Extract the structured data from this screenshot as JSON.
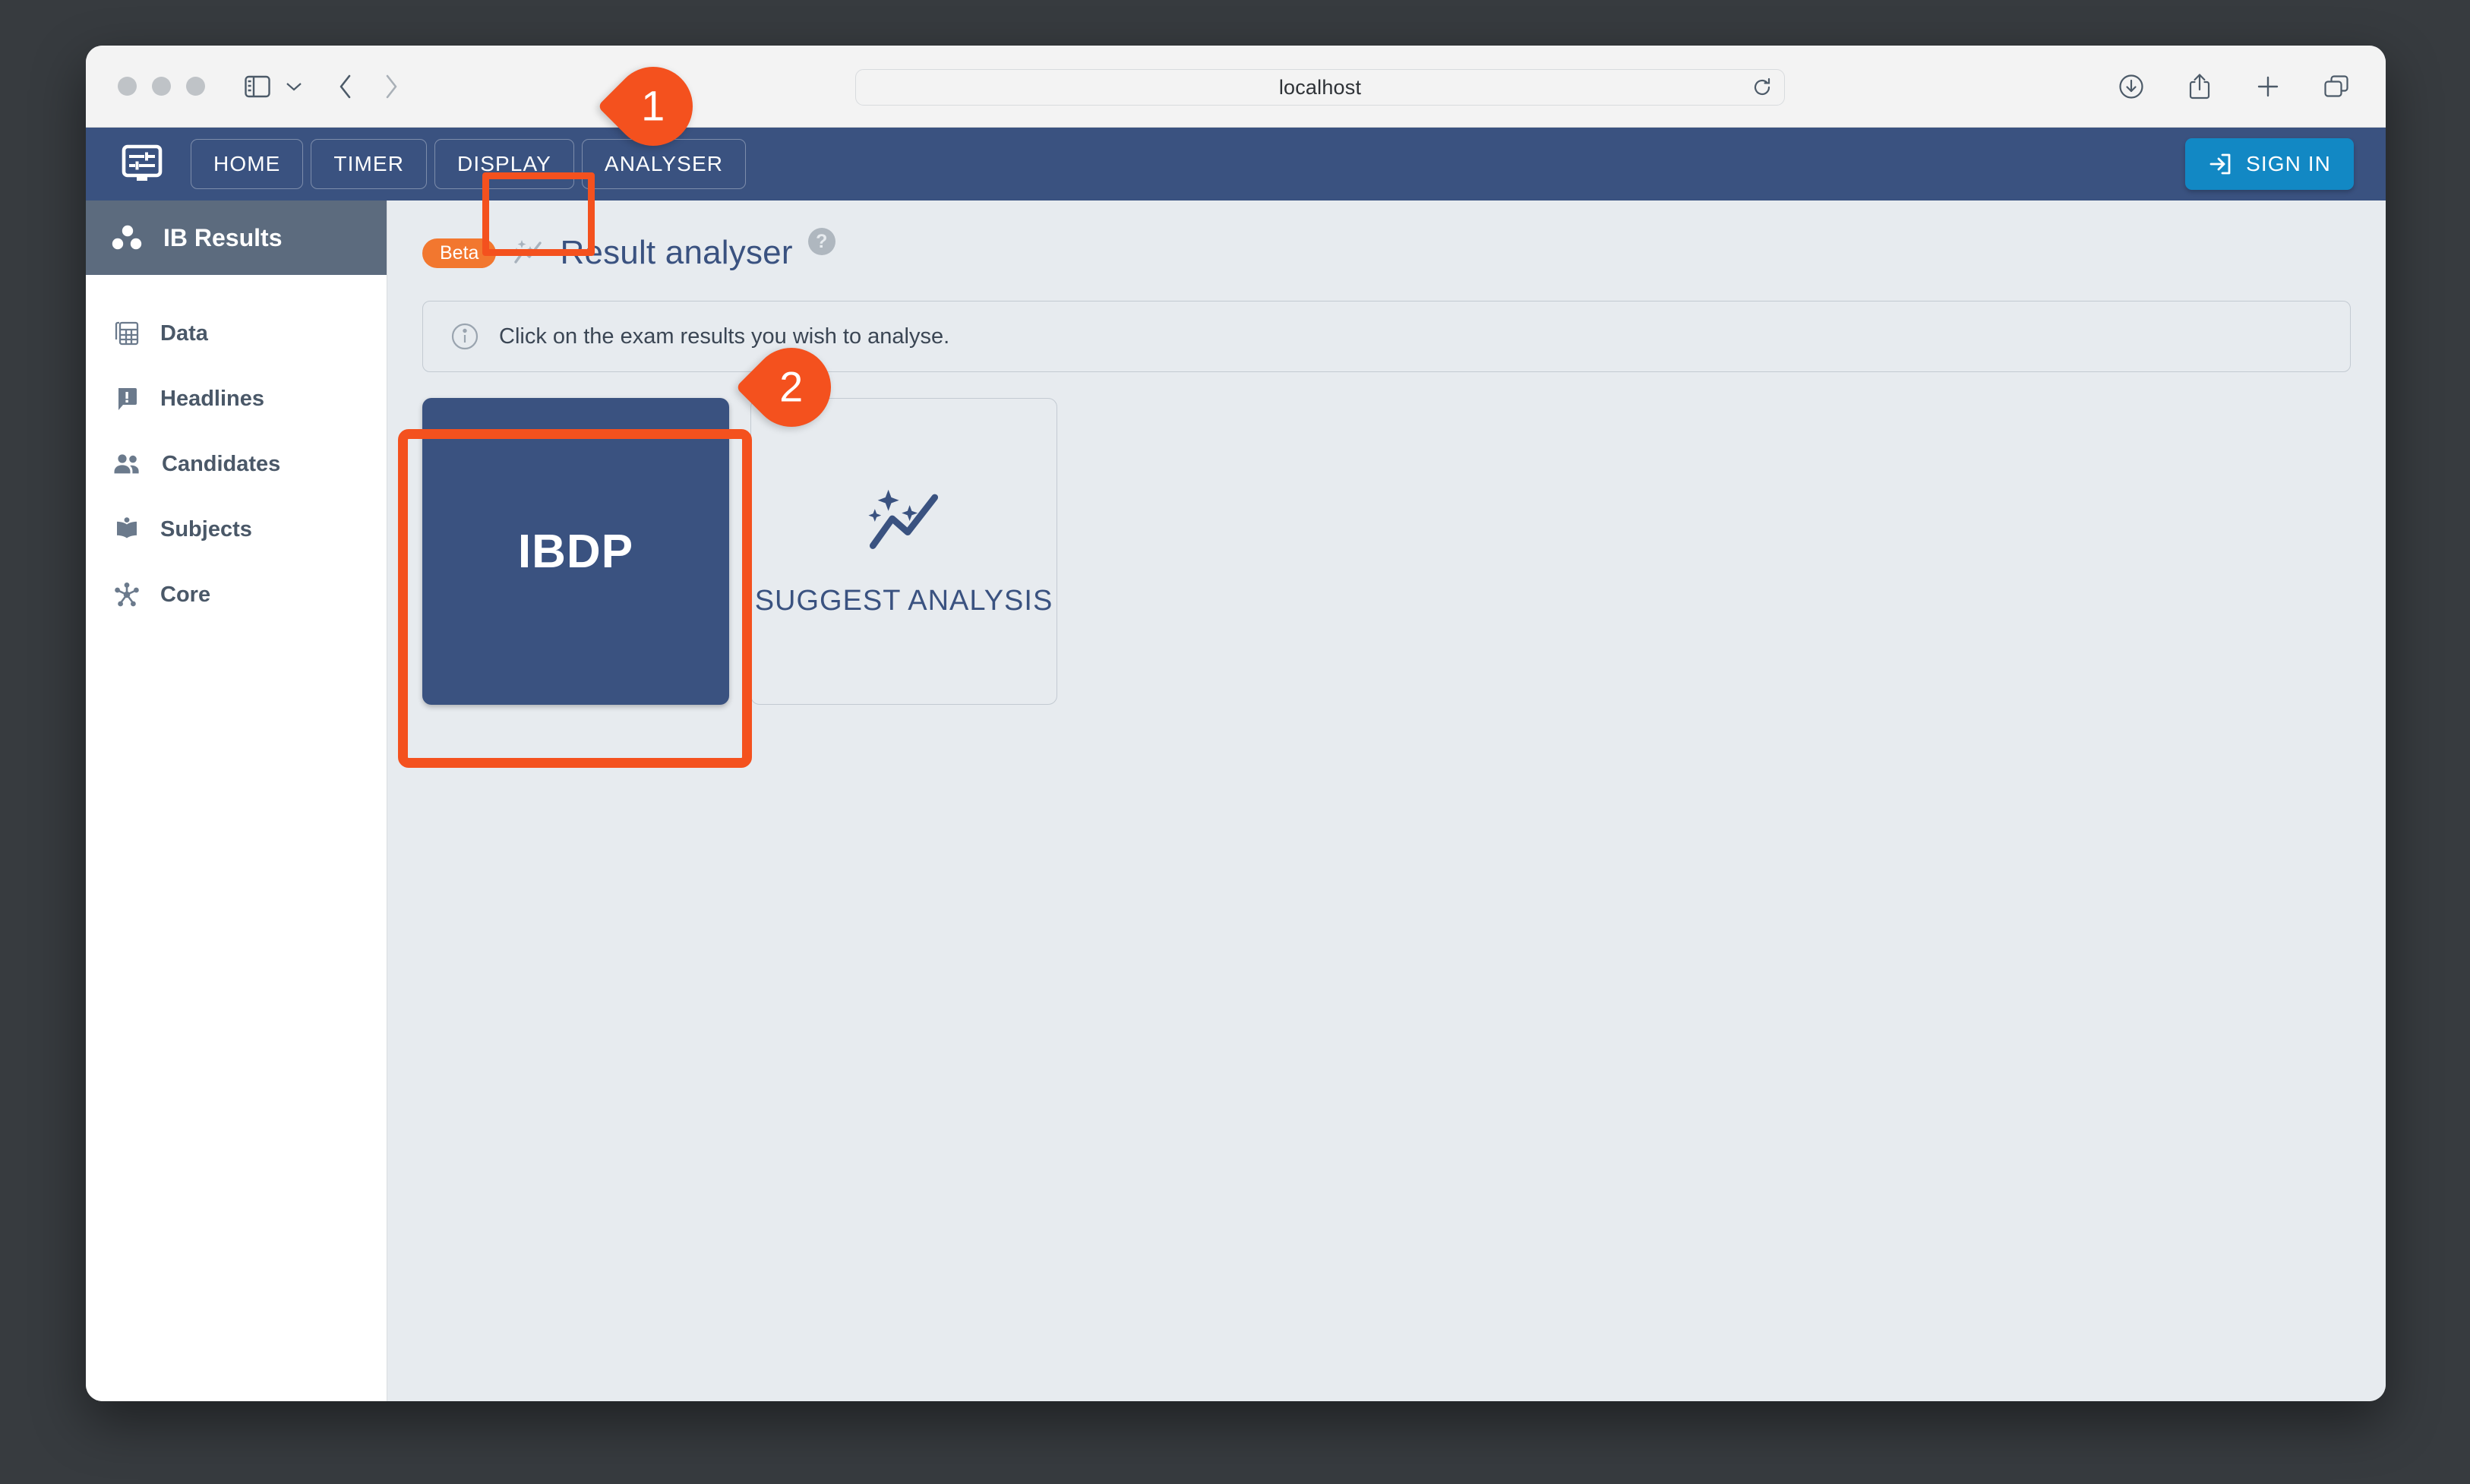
{
  "browser": {
    "traffic_lights": [
      "close",
      "minimize",
      "maximize"
    ],
    "sidebar_toggle_icon": "sidebar-toggle-icon",
    "sidebar_chevron_icon": "chevron-down-icon",
    "back_icon": "chevron-left-icon",
    "forward_icon": "chevron-right-icon",
    "url": "localhost",
    "reload_icon": "reload-icon",
    "right_icons": [
      {
        "name": "downloads-icon"
      },
      {
        "name": "share-icon"
      },
      {
        "name": "new-tab-icon"
      },
      {
        "name": "tab-overview-icon"
      }
    ]
  },
  "app_nav": {
    "logo_icon": "display-settings-icon",
    "buttons": [
      {
        "label": "HOME",
        "name": "nav-button-home"
      },
      {
        "label": "TIMER",
        "name": "nav-button-timer"
      },
      {
        "label": "DISPLAY",
        "name": "nav-button-display"
      },
      {
        "label": "ANALYSER",
        "name": "nav-button-analyser"
      }
    ],
    "sign_in": {
      "label": "SIGN IN",
      "icon": "login-icon",
      "color": "#1288C4"
    }
  },
  "sidebar": {
    "title": "IB Results",
    "logo_icon": "three-dots-cluster-icon",
    "items": [
      {
        "label": "Data",
        "icon": "table-icon"
      },
      {
        "label": "Headlines",
        "icon": "announcement-icon"
      },
      {
        "label": "Candidates",
        "icon": "people-icon"
      },
      {
        "label": "Subjects",
        "icon": "book-icon"
      },
      {
        "label": "Core",
        "icon": "hub-icon"
      }
    ]
  },
  "main": {
    "badge": "Beta",
    "title_icon": "auto-graph-icon",
    "title": "Result analyser",
    "help_icon": "help-icon",
    "help_glyph": "?",
    "info": {
      "icon": "info-icon",
      "text": "Click on the exam results you wish to analyse."
    },
    "cards": [
      {
        "label": "IBDP",
        "name": "card-ibdp",
        "style": "filled"
      },
      {
        "label": "SUGGEST ANALYSIS",
        "name": "card-suggest-analysis",
        "style": "outline",
        "icon": "auto-graph-icon"
      }
    ]
  },
  "annotations": {
    "steps": [
      {
        "number": "1",
        "target": "nav-button-display"
      },
      {
        "number": "2",
        "target": "card-ibdp"
      }
    ],
    "highlight_color": "#F4511E"
  },
  "colors": {
    "nav_blue": "#3A5280",
    "sidebar_header": "#5C6B7E",
    "content_bg": "#E7EBEF",
    "beta_orange": "#F2772F",
    "signin_blue": "#1288C4",
    "highlight_orange": "#F4511E"
  }
}
